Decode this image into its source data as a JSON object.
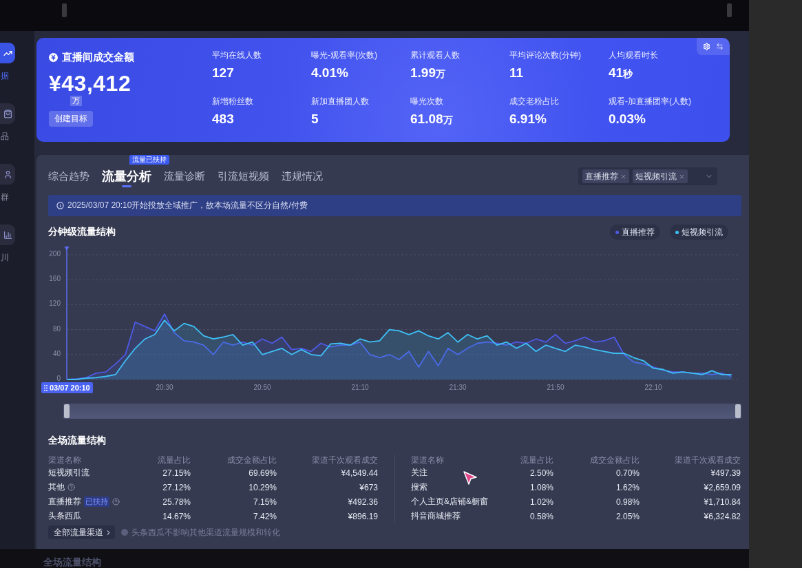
{
  "sidebar": {
    "items": [
      {
        "label": "据",
        "selected": true
      },
      {
        "label": "品",
        "selected": false
      },
      {
        "label": "群",
        "selected": false
      },
      {
        "label": "川",
        "selected": false
      }
    ]
  },
  "banner": {
    "total": {
      "label": "直播间成交金额",
      "value": "¥43,412",
      "unit": "万"
    },
    "goal_button": "创建目标",
    "metrics": [
      {
        "label": "平均在线人数",
        "value": "127"
      },
      {
        "label": "曝光-观看率(次数)",
        "value": "4.01%"
      },
      {
        "label": "累计观看人数",
        "value": "1.99",
        "unit": "万"
      },
      {
        "label": "平均评论次数(分钟)",
        "value": "11"
      },
      {
        "label": "人均观看时长",
        "value": "41",
        "unit": "秒"
      },
      {
        "label": "新增粉丝数",
        "value": "483"
      },
      {
        "label": "新加直播团人数",
        "value": "5"
      },
      {
        "label": "曝光次数",
        "value": "61.08",
        "unit": "万"
      },
      {
        "label": "成交老粉占比",
        "value": "6.91%"
      },
      {
        "label": "观看-加直播团率(人数)",
        "value": "0.03%"
      }
    ]
  },
  "panel": {
    "tabs": [
      {
        "label": "综合趋势",
        "selected": false
      },
      {
        "label": "流量分析",
        "selected": true,
        "badge": "流量已扶持"
      },
      {
        "label": "流量诊断",
        "selected": false
      },
      {
        "label": "引流短视频",
        "selected": false
      },
      {
        "label": "违规情况",
        "selected": false
      }
    ],
    "filter": {
      "tags": [
        "直播推荐",
        "短视频引流"
      ]
    },
    "notice": "2025/03/07 20:10开始投放全域推广，故本场流量不区分自然/付费",
    "chart": {
      "cursor_label": "03/07 20:10",
      "zoom_slider": {
        "level": 1
      },
      "chart_data": {
        "type": "area",
        "title": "分钟级流量结构",
        "grid": true,
        "categories": [
          null,
          null,
          null,
          null,
          null,
          null,
          null,
          null,
          null,
          null,
          "20:30",
          null,
          null,
          null,
          null,
          null,
          null,
          null,
          null,
          null,
          "20:50",
          null,
          null,
          null,
          null,
          null,
          null,
          null,
          null,
          null,
          "21:10",
          null,
          null,
          null,
          null,
          null,
          null,
          null,
          null,
          null,
          "21:30",
          null,
          null,
          null,
          null,
          null,
          null,
          null,
          null,
          null,
          "21:50",
          null,
          null,
          null,
          null,
          null,
          null,
          null,
          null,
          null,
          "22:10",
          null,
          null,
          null,
          null,
          null,
          null,
          null,
          null
        ],
        "ylim": [
          0,
          200
        ],
        "yticks": [
          0,
          40,
          80,
          120,
          160,
          200
        ],
        "series": [
          {
            "name": "直播推荐",
            "color": "#4d5be6",
            "values": [
              0,
              1,
              3,
              10,
              12,
              25,
              40,
              92,
              85,
              78,
              105,
              75,
              62,
              60,
              55,
              40,
              60,
              55,
              60,
              55,
              65,
              58,
              68,
              48,
              50,
              45,
              58,
              52,
              55,
              55,
              60,
              40,
              35,
              40,
              32,
              45,
              20,
              45,
              22,
              50,
              40,
              50,
              58,
              60,
              58,
              55,
              60,
              58,
              65,
              60,
              72,
              58,
              62,
              68,
              60,
              62,
              68,
              40,
              28,
              25,
              20,
              15,
              12,
              12,
              10,
              10,
              8,
              10,
              5
            ]
          },
          {
            "name": "短视频引流",
            "color": "#3ec0f5",
            "values": [
              0,
              0,
              2,
              3,
              5,
              8,
              30,
              50,
              65,
              72,
              95,
              78,
              90,
              85,
              70,
              65,
              68,
              72,
              55,
              60,
              40,
              45,
              50,
              40,
              48,
              40,
              38,
              57,
              58,
              55,
              65,
              60,
              62,
              80,
              78,
              72,
              78,
              70,
              65,
              75,
              60,
              72,
              65,
              70,
              55,
              60,
              50,
              58,
              45,
              55,
              50,
              45,
              55,
              52,
              48,
              45,
              42,
              42,
              35,
              30,
              18,
              16,
              10,
              12,
              10,
              8,
              14,
              8,
              8
            ]
          }
        ]
      }
    },
    "traffic": {
      "title": "全场流量结构",
      "tables": [
        {
          "columns": [
            "渠道名称",
            "流量占比",
            "成交金额占比",
            "渠道千次观看成交"
          ],
          "rows": [
            {
              "channel": "短视频引流",
              "help": false,
              "values": [
                "27.15%",
                "69.69%",
                "¥4,549.44"
              ]
            },
            {
              "channel": "其他",
              "help": true,
              "values": [
                "27.12%",
                "10.29%",
                "¥673"
              ]
            },
            {
              "channel": "直播推荐",
              "badge": "已扶持",
              "help": true,
              "values": [
                "25.78%",
                "7.15%",
                "¥492.36"
              ]
            },
            {
              "channel": "头条西瓜",
              "help": false,
              "values": [
                "14.67%",
                "7.42%",
                "¥896.19"
              ]
            }
          ]
        },
        {
          "columns": [
            "渠道名称",
            "流量占比",
            "成交金额占比",
            "渠道千次观看成交"
          ],
          "rows": [
            {
              "channel": "关注",
              "help": false,
              "values": [
                "2.50%",
                "0.70%",
                "¥497.39"
              ]
            },
            {
              "channel": "搜索",
              "help": false,
              "values": [
                "1.08%",
                "1.62%",
                "¥2,659.09"
              ]
            },
            {
              "channel": "个人主页&店铺&橱窗",
              "help": false,
              "values": [
                "1.02%",
                "0.98%",
                "¥1,710.84"
              ]
            },
            {
              "channel": "抖音商城推荐",
              "help": false,
              "values": [
                "0.58%",
                "2.05%",
                "¥6,324.82"
              ]
            }
          ]
        }
      ],
      "all_channels_button": "全部流量渠道",
      "note": "头条西瓜不影响其他渠道流量规模和转化"
    }
  },
  "footer_peek": {
    "title": "全场流量结构"
  }
}
